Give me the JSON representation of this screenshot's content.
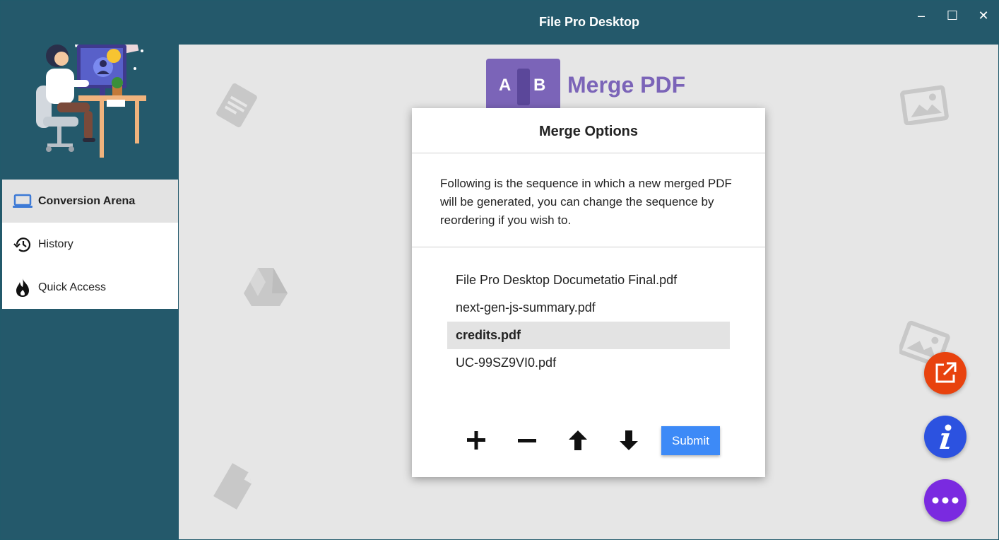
{
  "app": {
    "title": "File Pro Desktop",
    "window_controls": {
      "minimize": "–",
      "maximize": "☐",
      "close": "✕"
    }
  },
  "sidebar": {
    "items": [
      {
        "label": "Conversion Arena",
        "icon": "laptop-icon",
        "active": true
      },
      {
        "label": "History",
        "icon": "history-icon",
        "active": false
      },
      {
        "label": "Quick Access",
        "icon": "flame-icon",
        "active": false
      }
    ]
  },
  "main": {
    "tool": {
      "logo_letters": {
        "a": "A",
        "b": "B"
      },
      "title": "Merge PDF",
      "accent_color": "#7b64b8"
    }
  },
  "dialog": {
    "title": "Merge Options",
    "description": "Following is the sequence in which a new merged PDF will be generated, you can change the sequence by reordering if you wish to.",
    "files": [
      {
        "name": "File Pro Desktop Documetatio Final.pdf",
        "selected": false
      },
      {
        "name": "next-gen-js-summary.pdf",
        "selected": false
      },
      {
        "name": "credits.pdf",
        "selected": true
      },
      {
        "name": "UC-99SZ9VI0.pdf",
        "selected": false
      }
    ],
    "actions": {
      "add": "plus-icon",
      "remove": "minus-icon",
      "move_up": "arrow-up-icon",
      "move_down": "arrow-down-icon",
      "submit_label": "Submit"
    }
  },
  "fabs": [
    {
      "icon": "open-external-icon",
      "color": "#e8420e"
    },
    {
      "icon": "info-icon",
      "color": "#2c52e0"
    },
    {
      "icon": "more-icon",
      "color": "#7a2ae0"
    }
  ]
}
